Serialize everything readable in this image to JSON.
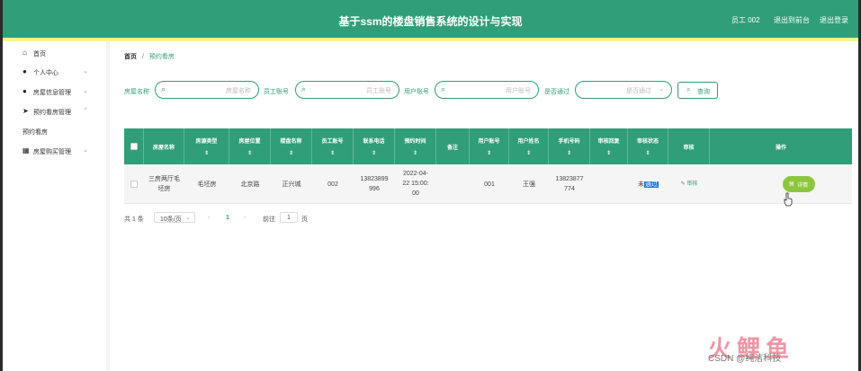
{
  "app": {
    "title": "基于ssm的楼盘销售系统的设计与实现",
    "nav": [
      "员工 002",
      "退出到前台",
      "退出登录"
    ]
  },
  "sidebar": {
    "items": [
      {
        "label": "首页",
        "icon": "home-icon",
        "expandable": false
      },
      {
        "label": "个人中心",
        "icon": "user-icon",
        "expandable": true
      },
      {
        "label": "房屋信息管理",
        "icon": "location-pin-icon",
        "expandable": true
      },
      {
        "label": "预约看房管理",
        "icon": "send-icon",
        "expandable": true
      },
      {
        "label": "预约看房",
        "icon": "",
        "expandable": false,
        "sub": true
      },
      {
        "label": "房屋购买管理",
        "icon": "grid-icon",
        "expandable": true
      }
    ]
  },
  "breadcrumb": {
    "home": "首页",
    "sep": "/",
    "current": "预约看房"
  },
  "filters": [
    {
      "label": "房屋名称",
      "placeholder": "房屋名称"
    },
    {
      "label": "员工账号",
      "placeholder": "员工账号"
    },
    {
      "label": "用户账号",
      "placeholder": "用户账号"
    },
    {
      "label": "是否通过",
      "placeholder": "是否通过"
    }
  ],
  "search_button": {
    "icon": "search-icon",
    "label": "查询"
  },
  "table": {
    "columns": [
      {
        "title": "房屋名称",
        "sort": "⇕"
      },
      {
        "title": "房源类型",
        "sort": "⇕"
      },
      {
        "title": "房屋位置",
        "sort": "⇕"
      },
      {
        "title": "楼盘名称",
        "sort": "⇕"
      },
      {
        "title": "员工账号",
        "sort": "⇕"
      },
      {
        "title": "联系电话",
        "sort": "⇕"
      },
      {
        "title": "预约时间",
        "sort": "⇕"
      },
      {
        "title": "备注",
        "sort": "⇕"
      },
      {
        "title": "用户账号",
        "sort": "⇕"
      },
      {
        "title": "用户姓名",
        "sort": "⇕"
      },
      {
        "title": "手机号码",
        "sort": "⇕"
      },
      {
        "title": "审核回复",
        "sort": "⇕"
      },
      {
        "title": "审核状态",
        "sort": "⇕"
      },
      {
        "title": "审核",
        "sort": "⇕"
      },
      {
        "title": "操作",
        "sort": ""
      }
    ],
    "rows": [
      {
        "name": [
          "三房两厅毛",
          "坯房"
        ],
        "type": "毛坯房",
        "location": "北京路",
        "estate": "正兴城",
        "staff_account": "002",
        "phone": [
          "13823899",
          "996"
        ],
        "time": [
          "2022-04-",
          "22 15:00:",
          "00"
        ],
        "remark": "",
        "user_account": "001",
        "user_name": "王强",
        "mobile": [
          "13823877",
          "774"
        ],
        "reply": "",
        "status_a": "未",
        "status_b": "通过",
        "review_label": "审核",
        "detail_label": "详情"
      }
    ]
  },
  "pager": {
    "total": "共 1 条",
    "page_size": "10条/页",
    "prev": "‹",
    "current": "1",
    "next": "›",
    "goto": "前往",
    "goto_value": "1",
    "page_unit": "页"
  },
  "watermark": {
    "logo": "火鲤鱼",
    "text": "CSDN @纯洁科技"
  },
  "colors": {
    "primary": "#2f9e79",
    "accent_bar": "#f6f48a",
    "detail_button": "#8cc63f"
  }
}
